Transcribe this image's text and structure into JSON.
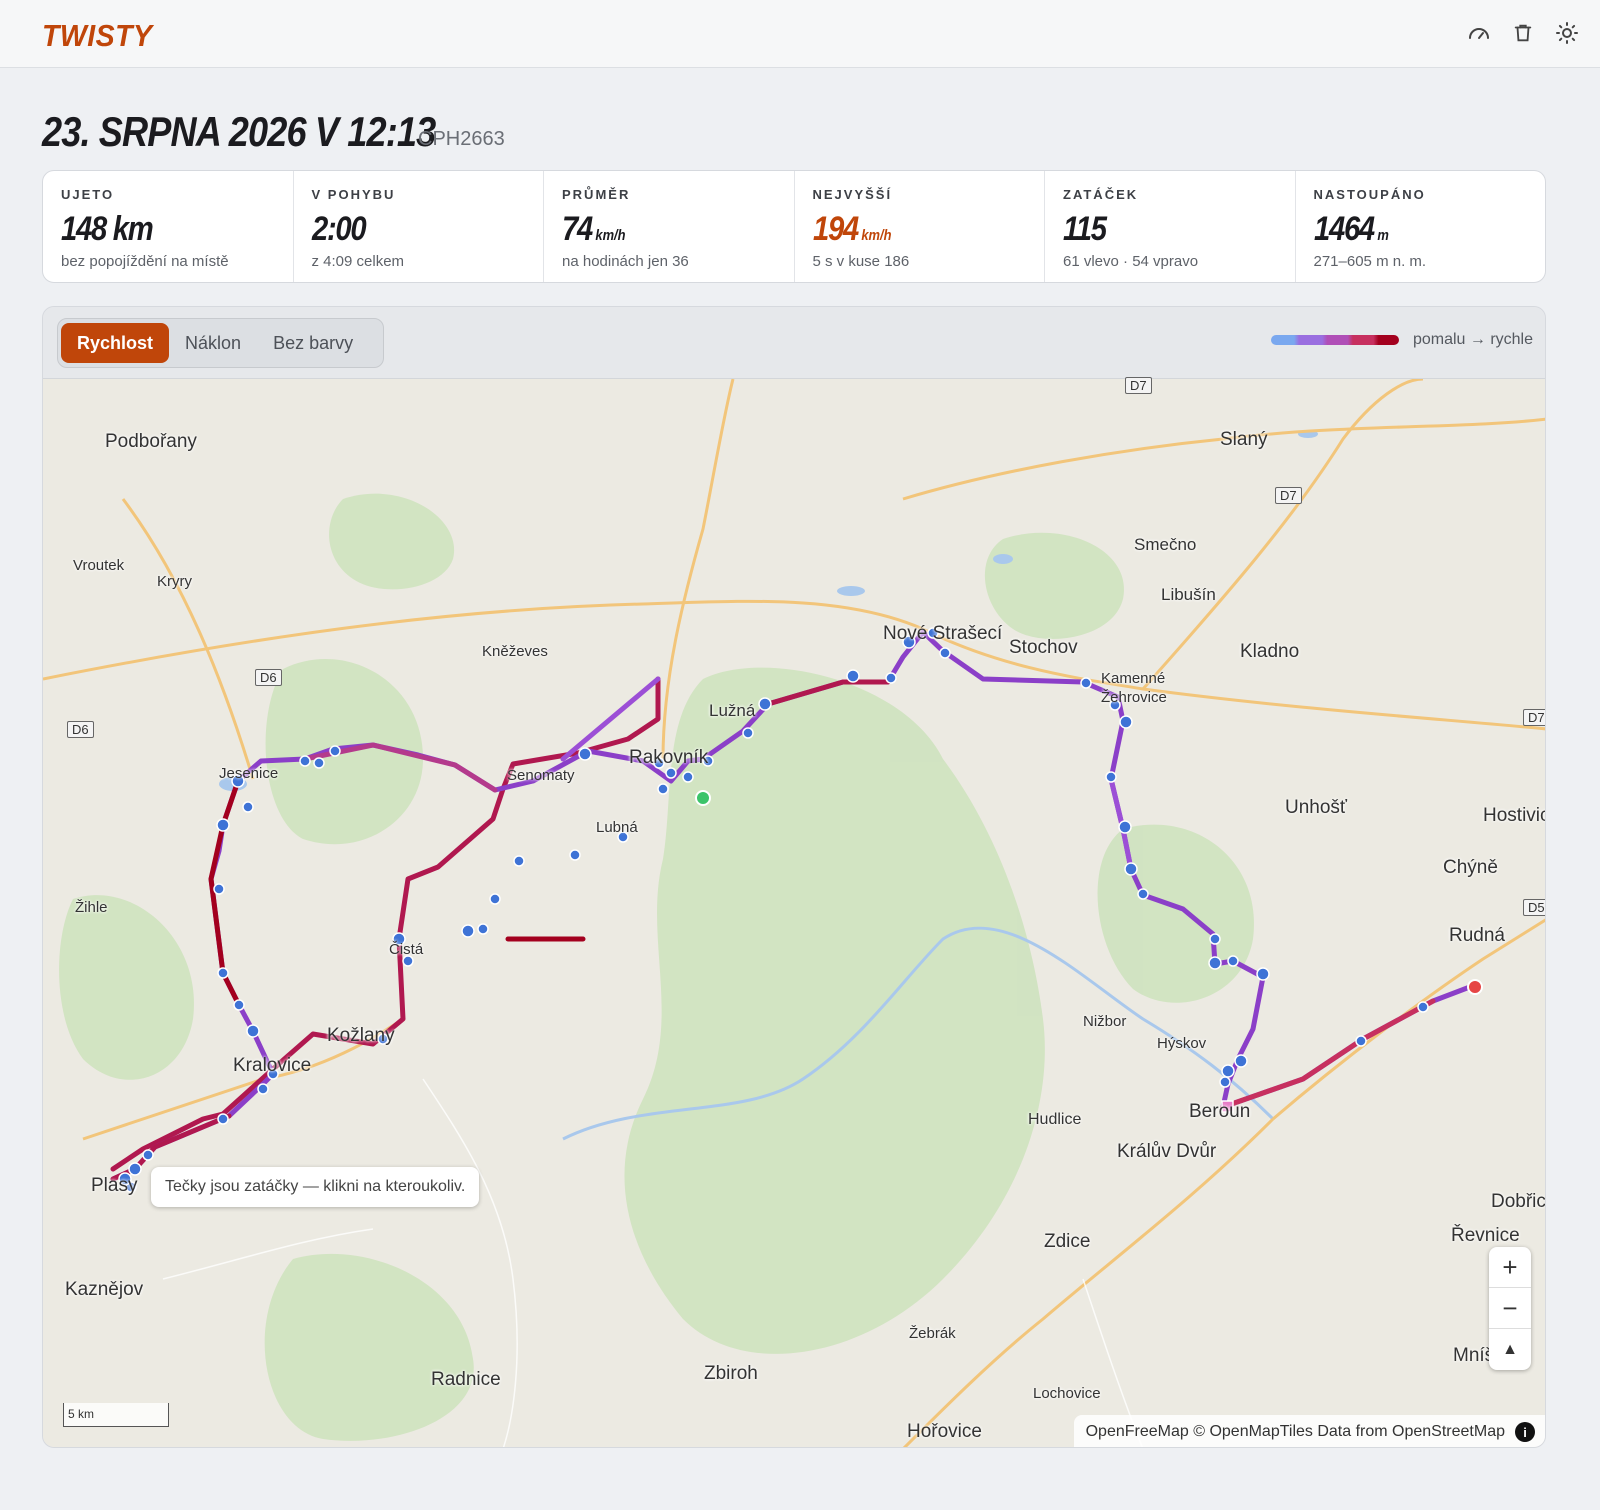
{
  "app": {
    "brand": "TWISTY"
  },
  "toolbar": {
    "icons": [
      "speedometer-icon",
      "trash-icon",
      "sun-icon"
    ]
  },
  "ride": {
    "title": "23. SRPNA 2026 V 12:13",
    "device": "CPH2663"
  },
  "stats": [
    {
      "label": "UJETO",
      "value": "148 km",
      "unit": "",
      "note": "bez popojíždění na místě"
    },
    {
      "label": "V POHYBU",
      "value": "2:00",
      "unit": "",
      "note": "z 4:09 celkem"
    },
    {
      "label": "PRŮMĚR",
      "value": "74",
      "unit": "km/h",
      "note": "na hodinách jen 36"
    },
    {
      "label": "NEJVYŠŠÍ",
      "value": "194",
      "unit": "km/h",
      "note": "5 s v kuse 186"
    },
    {
      "label": "ZATÁČEK",
      "value": "115",
      "unit": "",
      "note": "61 vlevo · 54 vpravo"
    },
    {
      "label": "NASTOUPÁNO",
      "value": "1464",
      "unit": "m",
      "note": "271–605 m n. m."
    }
  ],
  "colors": {
    "accent": "#c0460a",
    "speed_scale": [
      "#7aa8ef",
      "#9a6fe0",
      "#b04fb7",
      "#c7305f",
      "#a3001e"
    ]
  },
  "map": {
    "modes": [
      {
        "label": "Rychlost",
        "active": true
      },
      {
        "label": "Náklon",
        "active": false
      },
      {
        "label": "Bez barvy",
        "active": false
      }
    ],
    "legend_text": "pomalu → rychle",
    "tooltip": "Tečky jsou zatáčky — klikni na kteroukoliv.",
    "scale_text": "5 km",
    "attribution": "OpenFreeMap © OpenMapTiles Data from OpenStreetMap",
    "zoom_in": "+",
    "zoom_out": "−",
    "compass": "▲",
    "places": [
      "Podbořany",
      "Vroutek",
      "Kryry",
      "Slaný",
      "Smečno",
      "Libušín",
      "Kladno",
      "Nové Strašecí",
      "Stochov",
      "Kněževes",
      "Lužná",
      "Kamenné Žehrovice",
      "Jesenice",
      "Senomaty",
      "Rakovník",
      "Lubná",
      "Unhošť",
      "Hostivice",
      "Chýně",
      "Žihle",
      "Čistá",
      "Rudná",
      "Nižbor",
      "Hýskov",
      "Kožlany",
      "Kralovice",
      "Beroun",
      "Hudlice",
      "Králův Dvůr",
      "Plasy",
      "Dobřichovice",
      "Řevnice",
      "Zdice",
      "Kaznějov",
      "Žebrák",
      "Mníšek",
      "Radnice",
      "Zbiroh",
      "Lochovice",
      "Hořovice"
    ],
    "road_labels": [
      "D7",
      "D7",
      "D7",
      "D6",
      "D6",
      "D5"
    ]
  }
}
